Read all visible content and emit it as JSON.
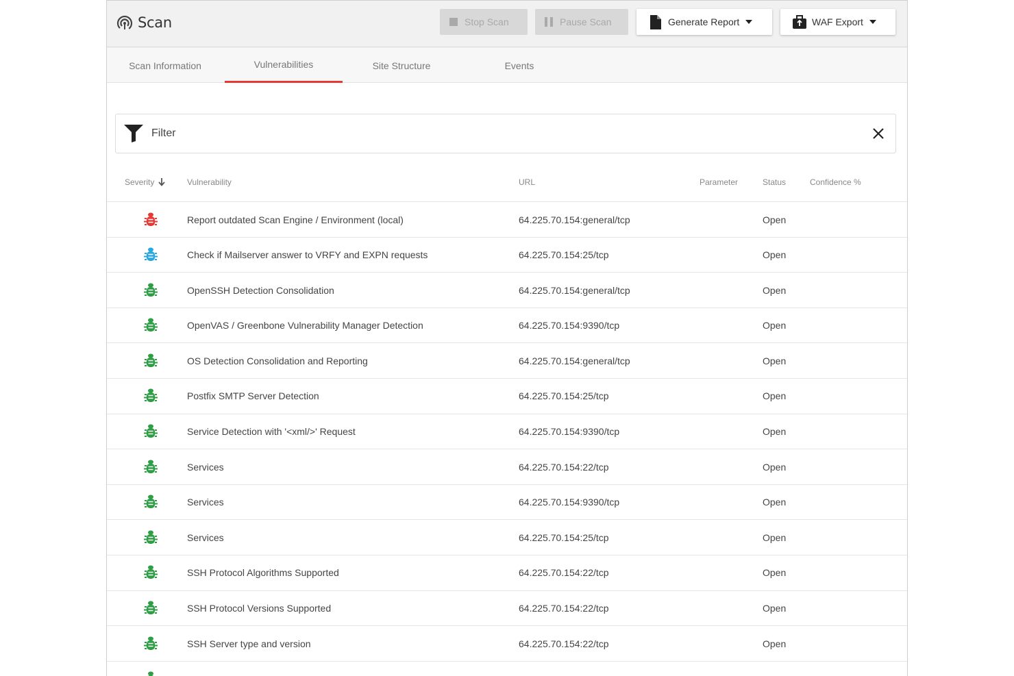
{
  "header": {
    "title": "Scan",
    "stop_label": "Stop Scan",
    "pause_label": "Pause Scan",
    "report_label": "Generate Report",
    "waf_label": "WAF Export"
  },
  "tabs": [
    {
      "label": "Scan Information",
      "active": false
    },
    {
      "label": "Vulnerabilities",
      "active": true
    },
    {
      "label": "Site Structure",
      "active": false
    },
    {
      "label": "Events",
      "active": false
    }
  ],
  "filter": {
    "label": "Filter"
  },
  "columns": {
    "severity": "Severity",
    "vulnerability": "Vulnerability",
    "url": "URL",
    "parameter": "Parameter",
    "status": "Status",
    "confidence": "Confidence %"
  },
  "colors": {
    "accent": "#e53935",
    "high": "#e53935",
    "low": "#29a8e0",
    "info": "#2e9e44"
  },
  "rows": [
    {
      "severity": "high",
      "vulnerability": "Report outdated Scan Engine / Environment (local)",
      "url": "64.225.70.154:general/tcp",
      "parameter": "",
      "status": "Open",
      "confidence": ""
    },
    {
      "severity": "low",
      "vulnerability": "Check if Mailserver answer to VRFY and EXPN requests",
      "url": "64.225.70.154:25/tcp",
      "parameter": "",
      "status": "Open",
      "confidence": ""
    },
    {
      "severity": "info",
      "vulnerability": "OpenSSH Detection Consolidation",
      "url": "64.225.70.154:general/tcp",
      "parameter": "",
      "status": "Open",
      "confidence": ""
    },
    {
      "severity": "info",
      "vulnerability": "OpenVAS / Greenbone Vulnerability Manager Detection",
      "url": "64.225.70.154:9390/tcp",
      "parameter": "",
      "status": "Open",
      "confidence": ""
    },
    {
      "severity": "info",
      "vulnerability": "OS Detection Consolidation and Reporting",
      "url": "64.225.70.154:general/tcp",
      "parameter": "",
      "status": "Open",
      "confidence": ""
    },
    {
      "severity": "info",
      "vulnerability": "Postfix SMTP Server Detection",
      "url": "64.225.70.154:25/tcp",
      "parameter": "",
      "status": "Open",
      "confidence": ""
    },
    {
      "severity": "info",
      "vulnerability": "Service Detection with '<xml/>' Request",
      "url": "64.225.70.154:9390/tcp",
      "parameter": "",
      "status": "Open",
      "confidence": ""
    },
    {
      "severity": "info",
      "vulnerability": "Services",
      "url": "64.225.70.154:22/tcp",
      "parameter": "",
      "status": "Open",
      "confidence": ""
    },
    {
      "severity": "info",
      "vulnerability": "Services",
      "url": "64.225.70.154:9390/tcp",
      "parameter": "",
      "status": "Open",
      "confidence": ""
    },
    {
      "severity": "info",
      "vulnerability": "Services",
      "url": "64.225.70.154:25/tcp",
      "parameter": "",
      "status": "Open",
      "confidence": ""
    },
    {
      "severity": "info",
      "vulnerability": "SSH Protocol Algorithms Supported",
      "url": "64.225.70.154:22/tcp",
      "parameter": "",
      "status": "Open",
      "confidence": ""
    },
    {
      "severity": "info",
      "vulnerability": "SSH Protocol Versions Supported",
      "url": "64.225.70.154:22/tcp",
      "parameter": "",
      "status": "Open",
      "confidence": ""
    },
    {
      "severity": "info",
      "vulnerability": "SSH Server type and version",
      "url": "64.225.70.154:22/tcp",
      "parameter": "",
      "status": "Open",
      "confidence": ""
    },
    {
      "severity": "info",
      "vulnerability": "",
      "url": "",
      "parameter": "",
      "status": "",
      "confidence": ""
    }
  ]
}
